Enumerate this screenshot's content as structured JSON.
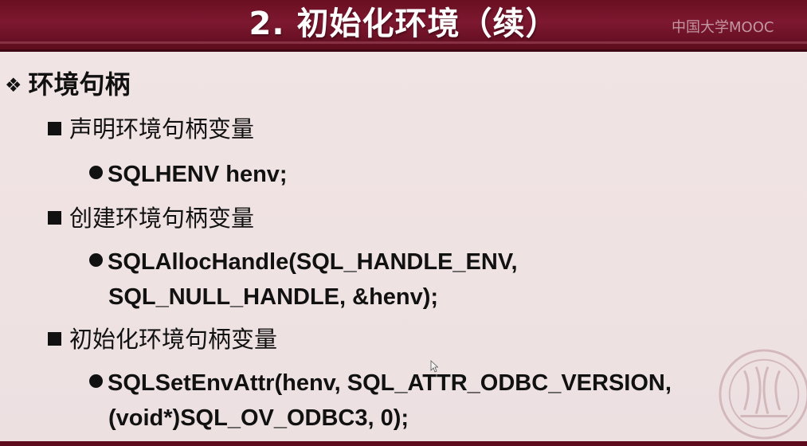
{
  "slide": {
    "title": "2. 初始化环境（续）",
    "watermark": "中国大学MOOC"
  },
  "content": {
    "heading": {
      "marker": "❖",
      "text": "环境句柄"
    },
    "sections": [
      {
        "label": "声明环境句柄变量",
        "code": [
          "SQLHENV henv;"
        ]
      },
      {
        "label": "创建环境句柄变量",
        "code": [
          "SQLAllocHandle(SQL_HANDLE_ENV,",
          "SQL_NULL_HANDLE, &henv);"
        ]
      },
      {
        "label": "初始化环境句柄变量",
        "code": [
          "SQLSetEnvAttr(henv, SQL_ATTR_ODBC_VERSION,",
          "(void*)SQL_OV_ODBC3, 0);"
        ]
      }
    ]
  },
  "icons": {
    "heading_marker": "diamond-bullet-icon",
    "section_bullet": "square-bullet-icon",
    "code_bullet": "round-bullet-icon",
    "seal": "university-seal-icon",
    "cursor": "mouse-pointer-icon"
  },
  "colors": {
    "title_bar": "#6a0f22",
    "title_text": "#ffffff",
    "background": "#efe2e3",
    "body_text": "#111111"
  }
}
